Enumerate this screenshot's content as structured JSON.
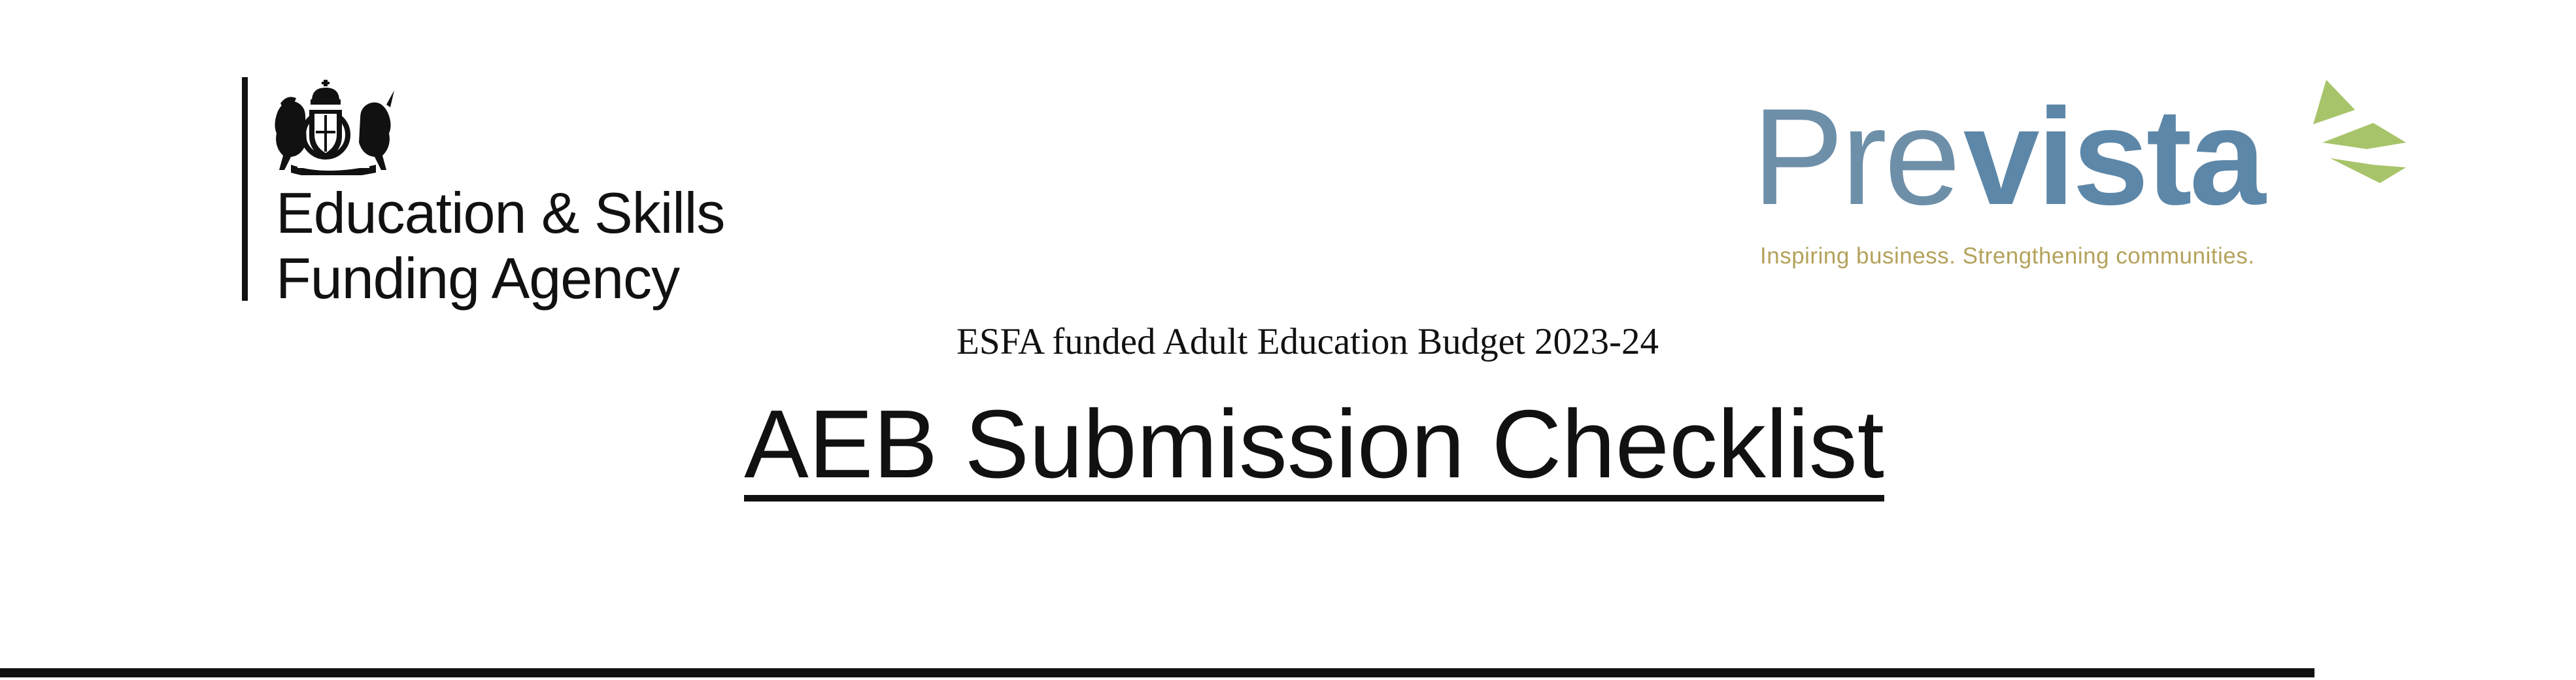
{
  "header": {
    "esfa_logo": {
      "line1": "Education & Skills",
      "line2": "Funding Agency",
      "crest_icon": "royal-coat-of-arms-icon"
    },
    "prevista_logo": {
      "wordmark_pre": "Pre",
      "wordmark_vista": "vista",
      "tagline": "Inspiring business. Strengthening communities.",
      "leaf_icon": "green-leaf-icon",
      "colors": {
        "pre": "#6e8fa8",
        "vista": "#5d87a8",
        "leaf": "#a8c46a",
        "tagline": "#b4a25c"
      }
    }
  },
  "document": {
    "subtitle": "ESFA funded Adult Education Budget 2023-24",
    "title": "AEB Submission Checklist"
  }
}
